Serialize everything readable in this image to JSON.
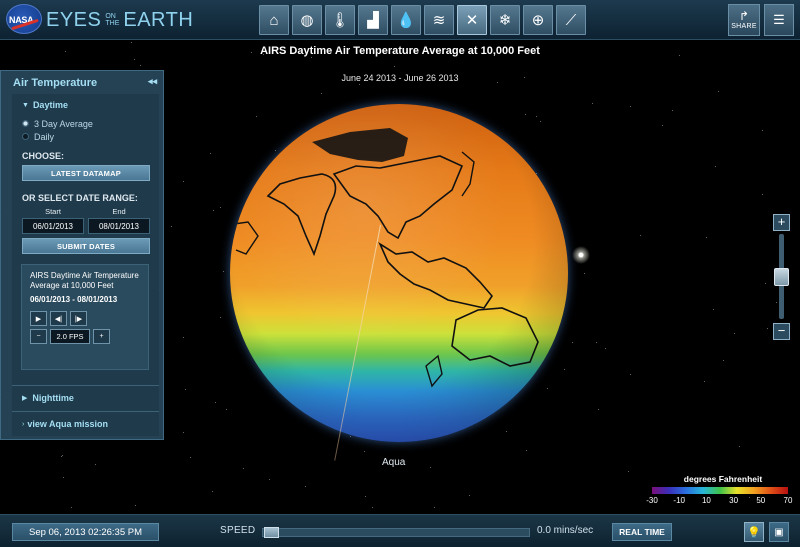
{
  "brand": {
    "logo_text": "NASA",
    "title_big": "EYES",
    "title_small_1": "ON",
    "title_small_2": "THE",
    "title_big_2": "EARTH"
  },
  "nav": {
    "buttons": [
      {
        "icon": "home-icon",
        "glyph": "⌂"
      },
      {
        "icon": "globe-icon",
        "glyph": "◍"
      },
      {
        "icon": "thermometer-icon",
        "glyph": "🌡"
      },
      {
        "icon": "factory-icon",
        "glyph": "▟"
      },
      {
        "icon": "water-drop-icon",
        "glyph": "💧"
      },
      {
        "icon": "waves-icon",
        "glyph": "≋"
      },
      {
        "icon": "satellite-icon",
        "glyph": "✕"
      },
      {
        "icon": "snowflake-icon",
        "glyph": "❄"
      },
      {
        "icon": "grid-globe-icon",
        "glyph": "⊕"
      },
      {
        "icon": "chart-icon",
        "glyph": "⟋"
      }
    ],
    "active_index": 6
  },
  "share": {
    "label": "SHARE"
  },
  "map": {
    "title": "AIRS Daytime Air Temperature Average at 10,000 Feet",
    "date_range": "June 24 2013 - June 26 2013",
    "satellite": "Aqua"
  },
  "panel": {
    "title": "Air Temperature",
    "daytime": {
      "label": "Daytime",
      "options": [
        {
          "label": "3 Day Average",
          "selected": true
        },
        {
          "label": "Daily",
          "selected": false
        }
      ]
    },
    "choose_label": "CHOOSE:",
    "latest_button": "LATEST DATAMAP",
    "select_range_label": "OR SELECT DATE RANGE:",
    "start_label": "Start",
    "end_label": "End",
    "start_value": "06/01/2013",
    "end_value": "08/01/2013",
    "submit_button": "SUBMIT DATES",
    "animation": {
      "description": "AIRS Daytime Air Temperature Average at 10,000 Feet",
      "range": "06/01/2013 - 08/01/2013",
      "fps": "2.0 FPS",
      "minus": "−",
      "plus": "+"
    },
    "nighttime_label": "Nighttime",
    "aqua_link": "view Aqua mission"
  },
  "zoom": {
    "in": "+",
    "out": "−"
  },
  "legend": {
    "title": "degrees Fahrenheit",
    "ticks": [
      "-30",
      "-10",
      "10",
      "30",
      "50",
      "70"
    ]
  },
  "bottom": {
    "datetime": "Sep 06, 2013 02:26:35 PM",
    "speed_label": "SPEED",
    "speed_value": "0.0 mins/sec",
    "realtime_button": "REAL TIME"
  },
  "colors": {
    "accent": "#a5dff4",
    "panel_bg": "#28485c",
    "button": "#4a7793"
  }
}
